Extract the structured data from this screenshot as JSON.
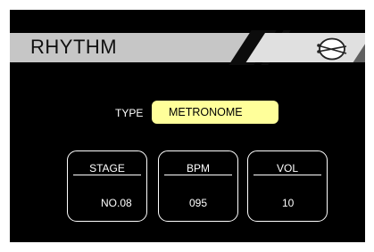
{
  "header": {
    "title": "RHYTHM",
    "icon": "drum-icon"
  },
  "type": {
    "label": "TYPE",
    "value": "METRONOME"
  },
  "params": [
    {
      "label": "STAGE",
      "value": "NO.08"
    },
    {
      "label": "BPM",
      "value": "095"
    },
    {
      "label": "VOL",
      "value": "10"
    }
  ],
  "colors": {
    "background": "#000000",
    "header": "#c6c6c6",
    "type_button": "#ffff9a"
  }
}
